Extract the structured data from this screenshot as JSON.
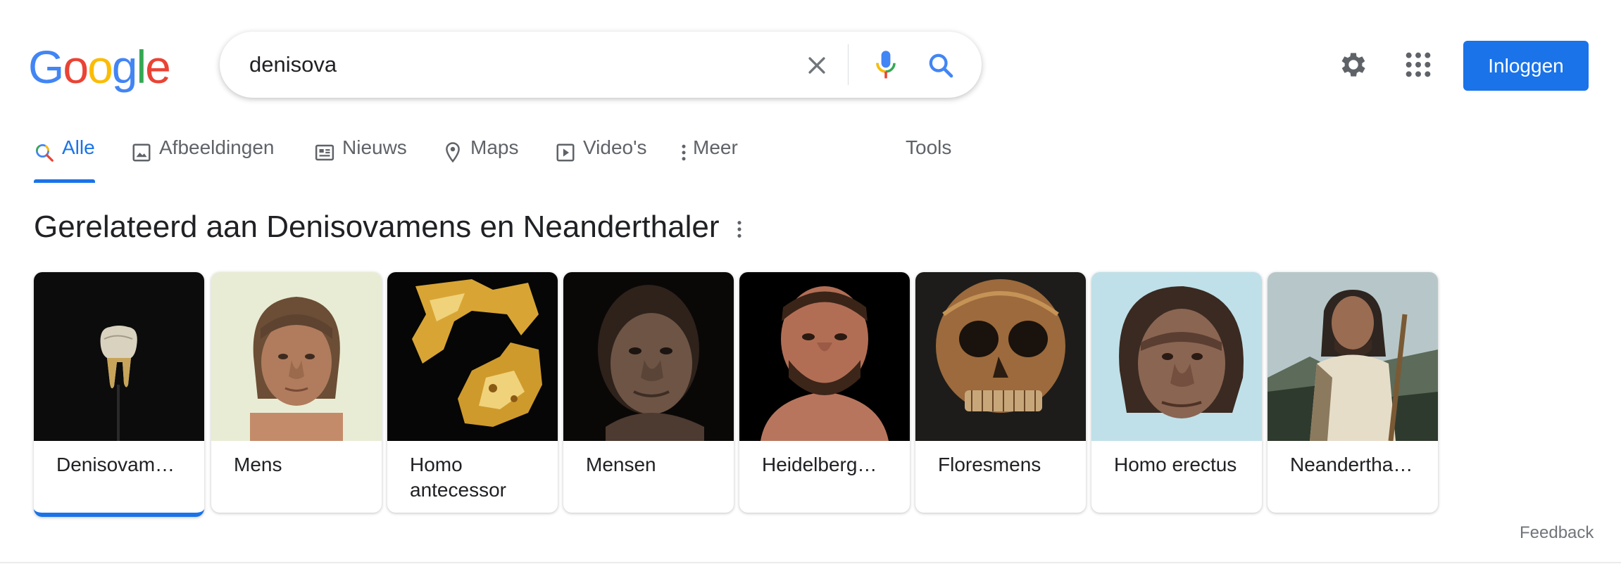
{
  "logo": {
    "text": "Google",
    "letters": [
      "G",
      "o",
      "o",
      "g",
      "l",
      "e"
    ],
    "colors": [
      "#4285F4",
      "#EA4335",
      "#FBBC05",
      "#4285F4",
      "#34A853",
      "#EA4335"
    ]
  },
  "search": {
    "query": "denisova",
    "clear_icon": "close-icon",
    "mic_icon": "microphone-icon",
    "search_icon": "search-icon"
  },
  "header": {
    "settings_icon": "gear-icon",
    "apps_icon": "apps-grid-icon",
    "login_label": "Inloggen"
  },
  "tabs": [
    {
      "label": "Alle",
      "icon": "search-icon",
      "active": true
    },
    {
      "label": "Afbeeldingen",
      "icon": "image-icon"
    },
    {
      "label": "Nieuws",
      "icon": "newspaper-icon"
    },
    {
      "label": "Maps",
      "icon": "map-pin-icon"
    },
    {
      "label": "Video's",
      "icon": "play-icon"
    },
    {
      "label": "Meer",
      "icon": "more-vert-icon"
    },
    {
      "label": "Tools"
    }
  ],
  "related": {
    "title": "Gerelateerd aan Denisovamens en Neanderthaler",
    "menu_icon": "more-vert-icon",
    "cards": [
      {
        "label": "Denisovam…",
        "selected": true
      },
      {
        "label": "Mens"
      },
      {
        "label": "Homo antecessor"
      },
      {
        "label": "Mensen"
      },
      {
        "label": "Heidelberg…"
      },
      {
        "label": "Floresmens"
      },
      {
        "label": "Homo erectus"
      },
      {
        "label": "Neandertha…"
      }
    ]
  },
  "footer": {
    "feedback_label": "Feedback"
  },
  "colors": {
    "accent": "#1a73e8",
    "text": "#202124",
    "muted": "#5f6368"
  }
}
